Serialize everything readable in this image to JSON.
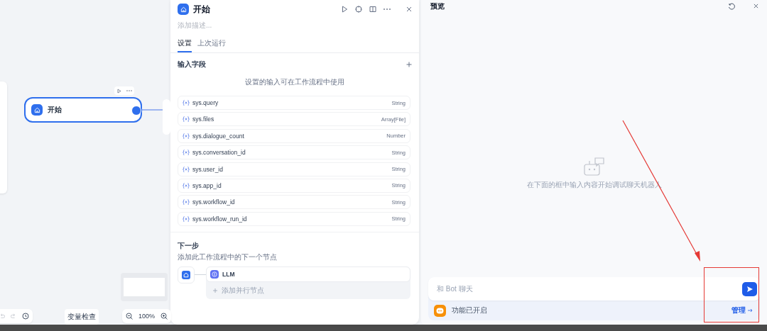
{
  "canvas": {
    "start_node": {
      "title": "开始"
    },
    "variable_check": "变量检查",
    "zoom": "100%"
  },
  "panel": {
    "title": "开始",
    "description_placeholder": "添加描述...",
    "tabs": [
      {
        "label": "设置",
        "selected": true
      },
      {
        "label": "上次运行",
        "selected": false
      }
    ],
    "input_section": {
      "title": "输入字段",
      "hint": "设置的输入可在工作流程中使用",
      "fields": [
        {
          "name": "sys.query",
          "type": "String"
        },
        {
          "name": "sys.files",
          "type": "Array[File]"
        },
        {
          "name": "sys.dialogue_count",
          "type": "Number"
        },
        {
          "name": "sys.conversation_id",
          "type": "String"
        },
        {
          "name": "sys.user_id",
          "type": "String"
        },
        {
          "name": "sys.app_id",
          "type": "String"
        },
        {
          "name": "sys.workflow_id",
          "type": "String"
        },
        {
          "name": "sys.workflow_run_id",
          "type": "String"
        }
      ]
    },
    "next_step": {
      "title": "下一步",
      "description": "添加此工作流程中的下一个节点",
      "nodes": [
        {
          "label": "LLM"
        }
      ],
      "add_parallel": "添加并行节点"
    }
  },
  "preview": {
    "title": "预览",
    "empty_hint": "在下面的框中输入内容开始调试聊天机器人",
    "chat_input": {
      "placeholder": "和 Bot 聊天"
    },
    "features": {
      "label": "功能已开启",
      "action": "管理"
    }
  }
}
